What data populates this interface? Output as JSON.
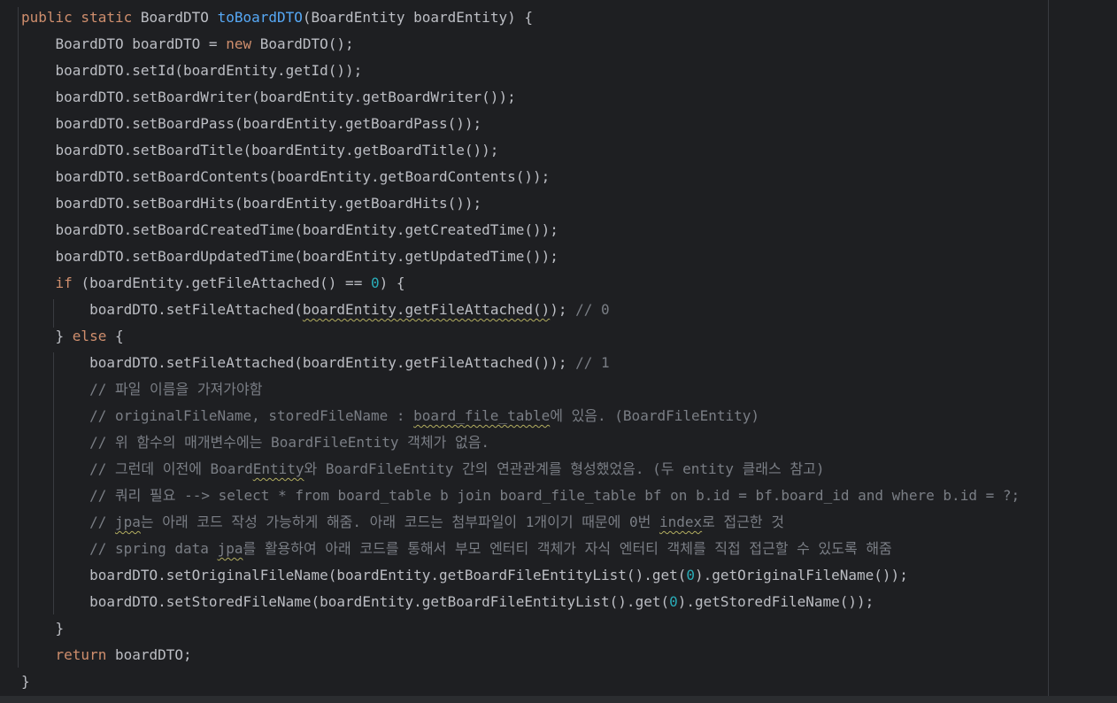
{
  "colors": {
    "background": "#1e1f22",
    "default_text": "#bcbec4",
    "keyword": "#cf8e6d",
    "method_declaration": "#56a8f5",
    "number": "#2aacb8",
    "comment": "#7a7e85",
    "typo_underline": "#b3ae60"
  },
  "code": {
    "lines": [
      [
        {
          "k": "kw",
          "t": "public static "
        },
        {
          "k": "txt",
          "t": "BoardDTO "
        },
        {
          "k": "fn",
          "t": "toBoardDTO"
        },
        {
          "k": "txt",
          "t": "(BoardEntity boardEntity) {"
        }
      ],
      [
        {
          "k": "txt",
          "t": "    BoardDTO boardDTO = "
        },
        {
          "k": "kw",
          "t": "new "
        },
        {
          "k": "txt",
          "t": "BoardDTO();"
        }
      ],
      [
        {
          "k": "txt",
          "t": "    boardDTO.setId(boardEntity.getId());"
        }
      ],
      [
        {
          "k": "txt",
          "t": "    boardDTO.setBoardWriter(boardEntity.getBoardWriter());"
        }
      ],
      [
        {
          "k": "txt",
          "t": "    boardDTO.setBoardPass(boardEntity.getBoardPass());"
        }
      ],
      [
        {
          "k": "txt",
          "t": "    boardDTO.setBoardTitle(boardEntity.getBoardTitle());"
        }
      ],
      [
        {
          "k": "txt",
          "t": "    boardDTO.setBoardContents(boardEntity.getBoardContents());"
        }
      ],
      [
        {
          "k": "txt",
          "t": "    boardDTO.setBoardHits(boardEntity.getBoardHits());"
        }
      ],
      [
        {
          "k": "txt",
          "t": "    boardDTO.setBoardCreatedTime(boardEntity.getCreatedTime());"
        }
      ],
      [
        {
          "k": "txt",
          "t": "    boardDTO.setBoardUpdatedTime(boardEntity.getUpdatedTime());"
        }
      ],
      [
        {
          "k": "txt",
          "t": "    "
        },
        {
          "k": "kw",
          "t": "if "
        },
        {
          "k": "txt",
          "t": "(boardEntity.getFileAttached() == "
        },
        {
          "k": "num",
          "t": "0"
        },
        {
          "k": "txt",
          "t": ") {"
        }
      ],
      [
        {
          "k": "txt",
          "t": "        boardDTO.setFileAttached("
        },
        {
          "k": "txt",
          "t": "boardEntity.getFileAttached()",
          "w": true
        },
        {
          "k": "txt",
          "t": "); "
        },
        {
          "k": "cmt",
          "t": "// 0"
        }
      ],
      [
        {
          "k": "txt",
          "t": "    } "
        },
        {
          "k": "kw",
          "t": "else "
        },
        {
          "k": "txt",
          "t": "{"
        }
      ],
      [
        {
          "k": "txt",
          "t": "        boardDTO.setFileAttached(boardEntity.getFileAttached()); "
        },
        {
          "k": "cmt",
          "t": "// 1"
        }
      ],
      [
        {
          "k": "cmt",
          "t": "        // 파일 이름을 가져가야함"
        }
      ],
      [
        {
          "k": "cmt",
          "t": "        // originalFileName, storedFileName : "
        },
        {
          "k": "cmt",
          "t": "board_file_table",
          "w": true
        },
        {
          "k": "cmt",
          "t": "에 있음. (BoardFileEntity)"
        }
      ],
      [
        {
          "k": "cmt",
          "t": "        // 위 함수의 매개변수에는 BoardFileEntity 객체가 없음."
        }
      ],
      [
        {
          "k": "cmt",
          "t": "        // 그런데 이전에 Board"
        },
        {
          "k": "cmt",
          "t": "Entity",
          "w": true
        },
        {
          "k": "cmt",
          "t": "와 BoardFileEntity 간의 연관관계를 형성했었음. (두 entity 클래스 참고)"
        }
      ],
      [
        {
          "k": "cmt",
          "t": "        // 쿼리 필요 --> select * from board_table b join board_file_table bf on b.id = bf.board_id and where b.id = ?;"
        }
      ],
      [
        {
          "k": "cmt",
          "t": "        // "
        },
        {
          "k": "cmt",
          "t": "jpa",
          "w": true
        },
        {
          "k": "cmt",
          "t": "는 아래 코드 작성 가능하게 해줌. 아래 코드는 첨부파일이 1개이기 때문에 0번 "
        },
        {
          "k": "cmt",
          "t": "index",
          "w": true
        },
        {
          "k": "cmt",
          "t": "로 접근한 것"
        }
      ],
      [
        {
          "k": "cmt",
          "t": "        // spring data "
        },
        {
          "k": "cmt",
          "t": "jpa",
          "w": true
        },
        {
          "k": "cmt",
          "t": "를 활용하여 아래 코드를 통해서 부모 엔터티 객체가 자식 엔터티 객체를 직접 접근할 수 있도록 해줌"
        }
      ],
      [
        {
          "k": "txt",
          "t": "        boardDTO.setOriginalFileName(boardEntity.getBoardFileEntityList().get("
        },
        {
          "k": "num",
          "t": "0"
        },
        {
          "k": "txt",
          "t": ").getOriginalFileName());"
        }
      ],
      [
        {
          "k": "txt",
          "t": "        boardDTO.setStoredFileName(boardEntity.getBoardFileEntityList().get("
        },
        {
          "k": "num",
          "t": "0"
        },
        {
          "k": "txt",
          "t": ").getStoredFileName());"
        }
      ],
      [
        {
          "k": "txt",
          "t": "    }"
        }
      ],
      [
        {
          "k": "txt",
          "t": "    "
        },
        {
          "k": "kw",
          "t": "return "
        },
        {
          "k": "txt",
          "t": "boardDTO;"
        }
      ],
      [
        {
          "k": "txt",
          "t": "}"
        }
      ]
    ]
  }
}
